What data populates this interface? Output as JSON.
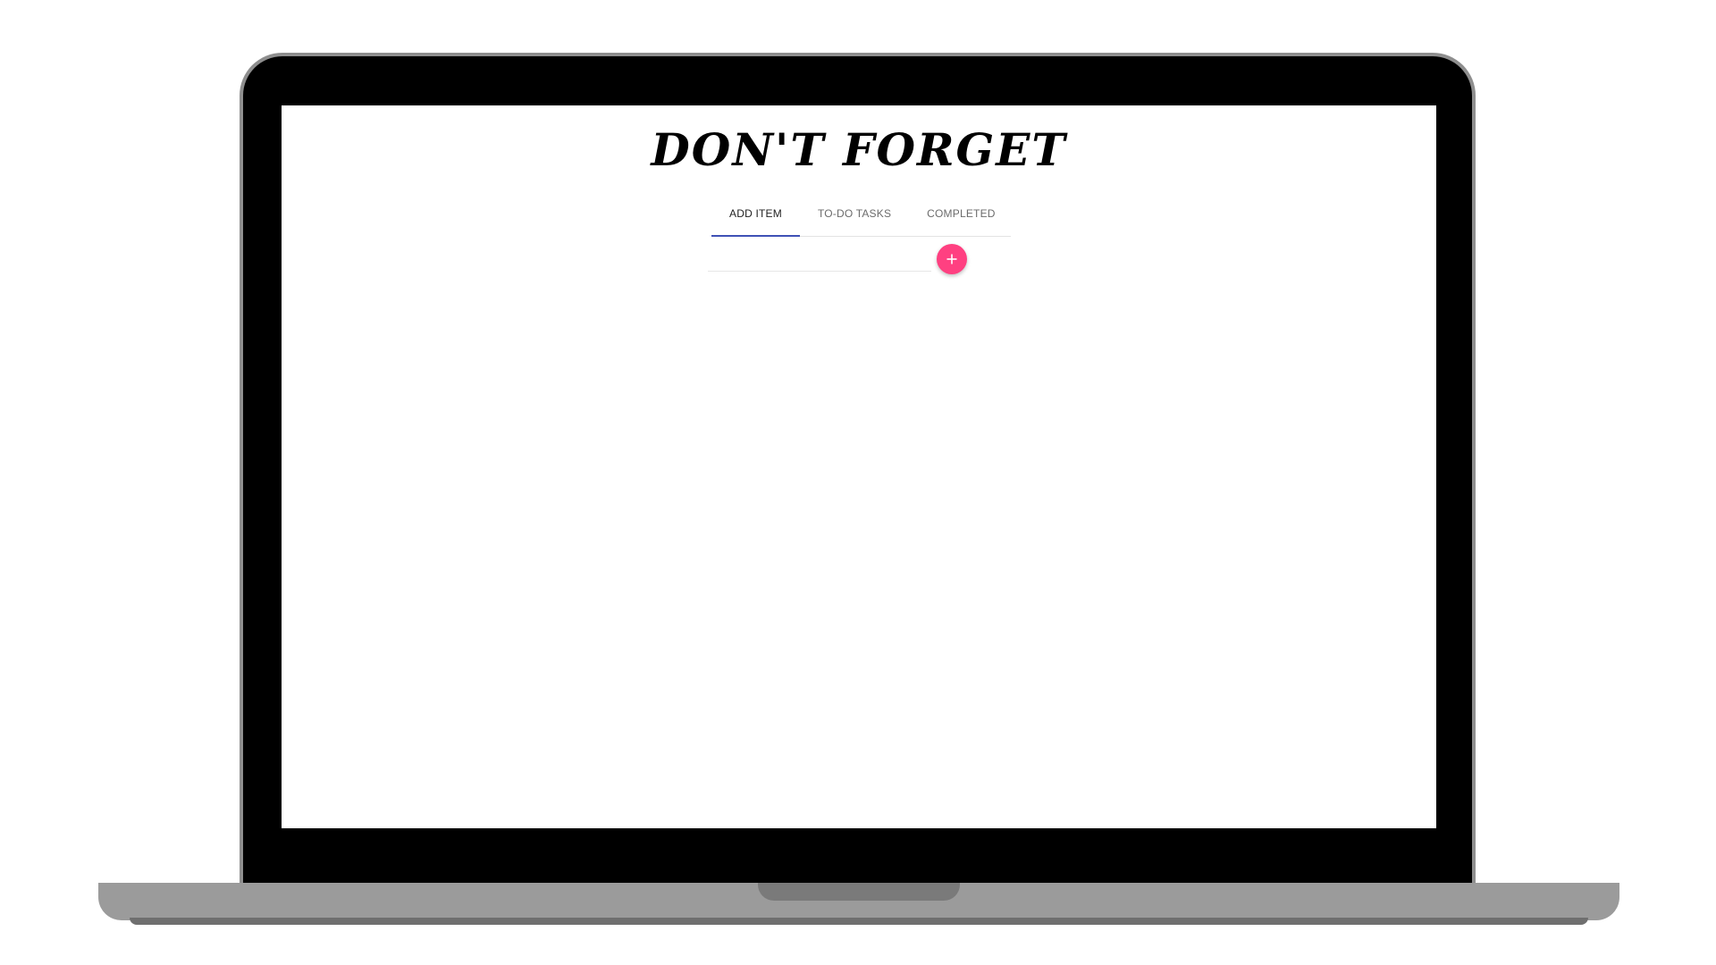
{
  "app": {
    "title": "DON'T FORGET"
  },
  "tabs": [
    {
      "label": "ADD ITEM",
      "active": true
    },
    {
      "label": "TO-DO TASKS",
      "active": false
    },
    {
      "label": "COMPLETED",
      "active": false
    }
  ],
  "add_item": {
    "input_value": "",
    "input_placeholder": "",
    "button_icon": "plus-icon"
  },
  "colors": {
    "accent_pink": "#ff4081",
    "tab_indicator": "#3f51b5",
    "laptop_frame": "#000000",
    "laptop_base": "#9b9b9b"
  }
}
